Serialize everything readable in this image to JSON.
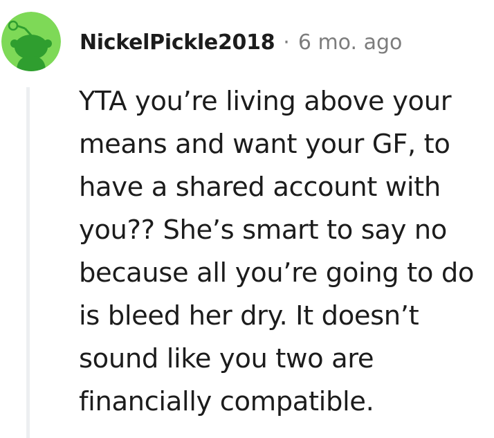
{
  "comment": {
    "author": "NickelPickle2018",
    "separator": "·",
    "timestamp": "6 mo. ago",
    "avatar_icon": "reddit-snoo-avatar-icon",
    "avatar_bg_color": "#7ed957",
    "avatar_snoo_color": "#2f9e2f",
    "body_lines": [
      "YTA you’re living above your",
      "means and want your GF, to",
      "have a shared account with",
      "you?? She’s smart to say no",
      "because all you’re going to do",
      "is bleed her dry. It doesn’t",
      "sound like you two are",
      "financially compatible."
    ]
  }
}
